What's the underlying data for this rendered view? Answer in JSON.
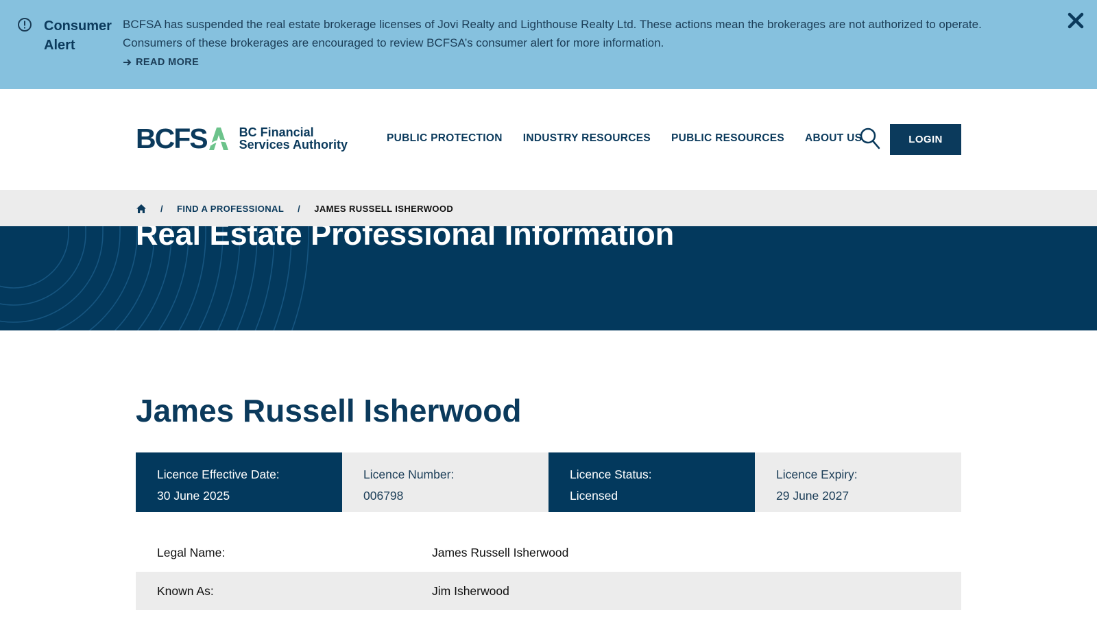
{
  "alert": {
    "title": "Consumer Alert",
    "body_line1": "BCFSA has suspended the real estate brokerage licenses of Jovi Realty and Lighthouse Realty Ltd. These actions mean the brokerages are not authorized to operate.",
    "body_line2": "Consumers of these brokerages are encouraged to review BCFSA’s consumer alert for more information.",
    "read_more": "READ MORE",
    "icon": "exclamation-circle-icon",
    "close_icon": "close-icon",
    "bg_color": "#86c1de"
  },
  "header": {
    "logo_letters": "BCFS",
    "logo_text_line1": "BC Financial",
    "logo_text_line2": "Services Authority",
    "nav": [
      "PUBLIC PROTECTION",
      "INDUSTRY RESOURCES",
      "PUBLIC RESOURCES",
      "ABOUT US"
    ],
    "search_icon": "search-icon",
    "login_label": "LOGIN",
    "brand_color": "#0b3a5c",
    "accent_color": "#6cc38b"
  },
  "breadcrumb": {
    "home_icon": "home-icon",
    "items": [
      "FIND A PROFESSIONAL",
      "JAMES RUSSELL ISHERWOOD"
    ]
  },
  "hero": {
    "title": "Real Estate Professional Information",
    "bg_color": "#03395d"
  },
  "profile": {
    "name": "James Russell Isherwood",
    "cards": [
      {
        "label": "Licence Effective Date:",
        "value": "30 June 2025"
      },
      {
        "label": "Licence Number:",
        "value": "006798"
      },
      {
        "label": "Licence Status:",
        "value": "Licensed"
      },
      {
        "label": "Licence Expiry:",
        "value": "29 June 2027"
      }
    ],
    "details": [
      {
        "label": "Legal Name:",
        "value": "James Russell Isherwood"
      },
      {
        "label": "Known As:",
        "value": "Jim Isherwood"
      }
    ]
  }
}
